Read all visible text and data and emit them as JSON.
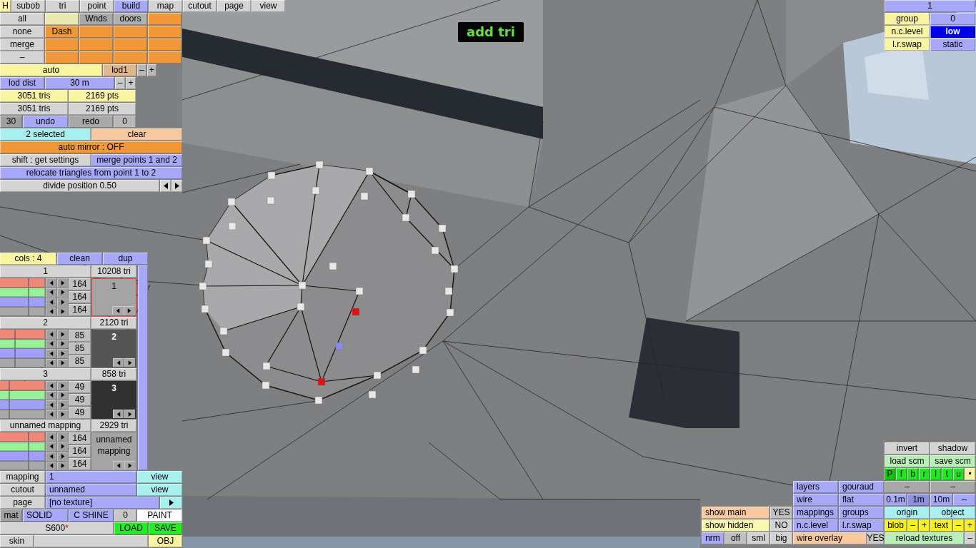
{
  "mode_label": "add tri",
  "panels": [
    {
      "rows": [
        {
          "buttons": [
            {
              "label": "H",
              "color": "#f8f4a0"
            },
            {
              "label": "subob",
              "color": "#d4d4d4"
            },
            {
              "label": "tri",
              "color": "#d4d4d4"
            },
            {
              "label": "point",
              "color": "#d4d4d4"
            },
            {
              "label": "build",
              "color": "#a8a8f8"
            },
            {
              "label": "map",
              "color": "#d4d4d4"
            },
            {
              "label": "cutout",
              "color": "#d4d4d4"
            },
            {
              "label": "page",
              "color": "#d4d4d4"
            },
            {
              "label": "view",
              "color": "#d4d4d4"
            }
          ]
        },
        {
          "buttons": [
            {
              "label": "all",
              "color": "#d4d4d4"
            },
            {
              "color": "#e8e8b0"
            },
            {
              "label": "Wnds",
              "color": "#a8a8a8"
            },
            {
              "label": "doors",
              "color": "#b0b0b0"
            },
            {
              "color": "#f09838"
            }
          ]
        },
        {
          "buttons": [
            {
              "label": "none",
              "color": "#d4d4d4"
            },
            {
              "label": "Dash",
              "color": "#f09838"
            },
            {
              "color": "#f09838"
            },
            {
              "color": "#f09838"
            },
            {
              "color": "#f09838"
            }
          ]
        },
        {
          "buttons": [
            {
              "label": "merge",
              "color": "#d4d4d4"
            },
            {
              "color": "#f09838"
            },
            {
              "color": "#f09838"
            },
            {
              "color": "#f09838"
            },
            {
              "color": "#f09838"
            }
          ]
        },
        {
          "buttons": [
            {
              "label": "–",
              "color": "#d4d4d4"
            },
            {
              "color": "#f09838"
            },
            {
              "color": "#f09838"
            },
            {
              "color": "#f09838"
            },
            {
              "color": "#f09838"
            }
          ]
        },
        {
          "buttons": [
            {
              "label": "auto",
              "color": "#f8f4a0"
            },
            {
              "label": "lod1",
              "color": "#e0b890"
            },
            {
              "label": "–",
              "color": "#b8b8b8"
            },
            {
              "label": "+",
              "color": "#b8b8b8"
            }
          ]
        },
        {
          "buttons": [
            {
              "label": "lod dist",
              "color": "#a8a8f8"
            },
            {
              "label": "30 m",
              "color": "#a8a8f8"
            },
            {
              "label": "–",
              "color": "#c8c8c8"
            },
            {
              "label": "+",
              "color": "#c8c8c8"
            }
          ]
        },
        {
          "buttons": [
            {
              "label": "3051 tris",
              "color": "#f8f4a0"
            },
            {
              "label": "2169 pts",
              "color": "#f8f4a0"
            }
          ]
        },
        {
          "buttons": [
            {
              "label": "3051 tris",
              "color": "#d4d4d4"
            },
            {
              "label": "2169 pts",
              "color": "#d4d4d4"
            }
          ]
        },
        {
          "buttons": [
            {
              "label": "30",
              "color": "#a0a0a0"
            },
            {
              "label": "undo",
              "color": "#a8a8f8"
            },
            {
              "label": "redo",
              "color": "#a8a8a8"
            },
            {
              "label": "0",
              "color": "#b8b8b8"
            }
          ]
        },
        {
          "buttons": [
            {
              "label": "2 selected",
              "color": "#a8f0f0"
            },
            {
              "label": "clear",
              "color": "#f8c8a0"
            }
          ]
        },
        {
          "buttons": [
            {
              "label": "auto mirror : OFF",
              "color": "#f09838"
            }
          ]
        },
        {
          "buttons": [
            {
              "label": "shift : get settings",
              "color": "#d4d4d4"
            },
            {
              "label": "merge points 1 and 2",
              "color": "#a8a8f8"
            }
          ]
        },
        {
          "buttons": [
            {
              "label": "relocate triangles from point 1 to 2",
              "color": "#a8a8f8"
            }
          ]
        },
        {
          "buttons": [
            {
              "label": "divide position 0.50",
              "color": "#d4d4d4"
            },
            {
              "kind": "left",
              "color": "#d4d4d4"
            },
            {
              "kind": "right",
              "color": "#d4d4d4"
            }
          ]
        }
      ]
    },
    {
      "rows": [
        {
          "buttons": [
            {
              "label": "mapping",
              "color": "#d4d4d4"
            },
            {
              "label": "1",
              "color": "#a8a8f8"
            },
            {
              "label": "view",
              "color": "#a8f0f0"
            }
          ]
        },
        {
          "buttons": [
            {
              "label": "cutout",
              "color": "#d4d4d4"
            },
            {
              "label": "unnamed",
              "color": "#a8a8f8"
            },
            {
              "label": "view",
              "color": "#a8f0f0"
            }
          ]
        },
        {
          "buttons": [
            {
              "label": "page",
              "color": "#d4d4d4"
            },
            {
              "label": "[no texture]",
              "color": "#a8a8f8"
            },
            {
              "kind": "right",
              "color": "#a8f0f0"
            }
          ]
        },
        {
          "buttons": [
            {
              "label": "mat",
              "color": "#a0a0a0"
            },
            {
              "label": "SOLID",
              "color": "#a8a8f8"
            },
            {
              "label": "C SHINE",
              "color": "#a8a8f8"
            },
            {
              "label": "0",
              "color": "#c8c8c8"
            },
            {
              "label": "PAINT",
              "color": "#ffffff"
            }
          ]
        },
        {
          "buttons": [
            {
              "label": "S600",
              "mark": "*",
              "color": "#d4d4d4"
            },
            {
              "label": "LOAD",
              "color": "#20f020"
            },
            {
              "label": "SAVE",
              "color": "#20f020"
            }
          ]
        },
        {
          "buttons": [
            {
              "label": "skin",
              "color": "#d4d4d4"
            },
            {
              "color": "#d4d4d4"
            },
            {
              "label": "OBJ",
              "color": "#f8f4a0"
            }
          ]
        }
      ]
    },
    {
      "rows": [
        {
          "buttons": [
            {
              "label": "1",
              "color": "#a8a8f8"
            }
          ]
        },
        {
          "buttons": [
            {
              "label": "group",
              "color": "#f8f4a0"
            },
            {
              "label": "0",
              "color": "#a8a8f8"
            }
          ]
        },
        {
          "buttons": [
            {
              "label": "n.c.level",
              "color": "#f8f4a0"
            },
            {
              "label": "low",
              "color": "#0000e8"
            }
          ]
        },
        {
          "buttons": [
            {
              "label": "l.r.swap",
              "color": "#f8f4a0"
            },
            {
              "label": "static",
              "color": "#a8a8f8"
            }
          ]
        }
      ]
    },
    {
      "rows": [
        {
          "buttons": [
            {
              "label": "invert",
              "color": "#d4d4d4"
            },
            {
              "label": "shadow",
              "color": "#d4d4d4"
            }
          ]
        },
        {
          "buttons": [
            {
              "label": "load scm",
              "color": "#b8f0b8"
            },
            {
              "label": "save scm",
              "color": "#b8f0b8"
            }
          ]
        },
        {
          "buttons": [
            {
              "label": "P",
              "color": "#10c810"
            },
            {
              "label": "f",
              "color": "#20e820"
            },
            {
              "label": "b",
              "color": "#20e820"
            },
            {
              "label": "r",
              "color": "#20e820"
            },
            {
              "label": "l",
              "color": "#20e820"
            },
            {
              "label": "t",
              "color": "#20e820"
            },
            {
              "label": "u",
              "color": "#20e820"
            },
            {
              "label": "•",
              "color": "#f8f4a0"
            }
          ]
        },
        {
          "buttons": [
            {
              "label": "layers",
              "color": "#a8a8f8"
            },
            {
              "label": "gouraud",
              "color": "#a8a8f8"
            },
            {
              "label": "–",
              "color": "#a8a8a8"
            },
            {
              "label": "–",
              "color": "#a8a8a8"
            }
          ]
        },
        {
          "buttons": [
            {
              "label": "wire",
              "color": "#a8a8f8"
            },
            {
              "label": "flat",
              "color": "#a8a8f8"
            },
            {
              "label": "0.1m",
              "color": "#a8a8f8"
            },
            {
              "label": "1m",
              "color": "#9090e0"
            },
            {
              "label": "10m",
              "color": "#a8a8f8"
            },
            {
              "label": "–",
              "color": "#a8a8f8"
            }
          ]
        },
        {
          "buttons": [
            {
              "label": "show main",
              "color": "#f8c8a0"
            },
            {
              "label": "YES",
              "color": "#c0c0c0"
            },
            {
              "label": "mappings",
              "color": "#a8a8f8"
            },
            {
              "label": "groups",
              "color": "#a8a8f8"
            },
            {
              "label": "origin",
              "color": "#a8f0f0"
            },
            {
              "label": "object",
              "color": "#a8f0f0"
            }
          ]
        },
        {
          "buttons": [
            {
              "label": "show hidden",
              "color": "#f8f8b0"
            },
            {
              "label": "NO",
              "color": "#d4d4d4"
            },
            {
              "label": "n.c.level",
              "color": "#a8a8f8"
            },
            {
              "label": "l.r.swap",
              "color": "#a8a8f8"
            },
            {
              "label": "blob",
              "color": "#f8f020"
            },
            {
              "label": "–",
              "color": "#f8f020"
            },
            {
              "label": "+",
              "color": "#f8f020"
            },
            {
              "label": "text",
              "color": "#f8f020"
            },
            {
              "label": "–",
              "color": "#f8f020"
            },
            {
              "label": "+",
              "color": "#f8f020"
            }
          ]
        },
        {
          "buttons": [
            {
              "label": "nrm",
              "color": "#a8a8f8"
            },
            {
              "label": "off",
              "color": "#c0c0c0"
            },
            {
              "label": "sml",
              "color": "#d4d4d4"
            },
            {
              "label": "big",
              "color": "#d4d4d4"
            },
            {
              "label": "wire overlay",
              "color": "#f8c8a0"
            },
            {
              "label": "YES",
              "color": "#c8c8c8"
            },
            {
              "label": "reload textures",
              "color": "#b8f0b8"
            },
            {
              "label": "–",
              "color": "#d4d4d4"
            }
          ]
        }
      ]
    }
  ],
  "color_groups": {
    "header": [
      {
        "label": "cols : 4",
        "color": "#f8f4a0"
      },
      {
        "label": "clean",
        "color": "#a8a8f8"
      },
      {
        "label": "dup",
        "color": "#a8a8f8"
      }
    ],
    "groups": [
      {
        "name": "1",
        "tri_count": "10208 tri",
        "values": [
          "164",
          "164",
          "164"
        ],
        "sliders": [
          {
            "color": "#f08878",
            "level": 0.64
          },
          {
            "color": "#98f098",
            "level": 0.64
          },
          {
            "color": "#a0a0f8",
            "level": 0.64
          },
          {
            "color": "#a8a8a8",
            "level": 0.64
          }
        ],
        "swatch": {
          "label": "1",
          "color": "#a4a4a4",
          "selected": true
        }
      },
      {
        "name": "2",
        "tri_count": "2120 tri",
        "values": [
          "85",
          "85",
          "85"
        ],
        "sliders": [
          {
            "color": "#f08878",
            "level": 0.33
          },
          {
            "color": "#98f098",
            "level": 0.33
          },
          {
            "color": "#a0a0f8",
            "level": 0.33
          },
          {
            "color": "#a8a8a8",
            "level": 0.33
          }
        ],
        "swatch": {
          "label": "2",
          "color": "#555555",
          "selected": false
        }
      },
      {
        "name": "3",
        "tri_count": "858 tri",
        "values": [
          "49",
          "49",
          "49"
        ],
        "sliders": [
          {
            "color": "#f08878",
            "level": 0.19
          },
          {
            "color": "#98f098",
            "level": 0.19
          },
          {
            "color": "#a0a0f8",
            "level": 0.19
          },
          {
            "color": "#a8a8a8",
            "level": 0.19
          }
        ],
        "swatch": {
          "label": "3",
          "color": "#313131",
          "selected": false
        }
      },
      {
        "name": "unnamed mapping",
        "tri_count": "2929 tri",
        "values": [
          "164",
          "164",
          "164"
        ],
        "sliders": [
          {
            "color": "#f08878",
            "level": 0.64
          },
          {
            "color": "#98f098",
            "level": 0.64
          },
          {
            "color": "#a0a0f8",
            "level": 0.64
          },
          {
            "color": "#a8a8a8",
            "level": 0.64
          }
        ],
        "swatch": {
          "label": "unnamed mapping",
          "color": "#a4a4a4",
          "selected": false
        }
      }
    ]
  }
}
